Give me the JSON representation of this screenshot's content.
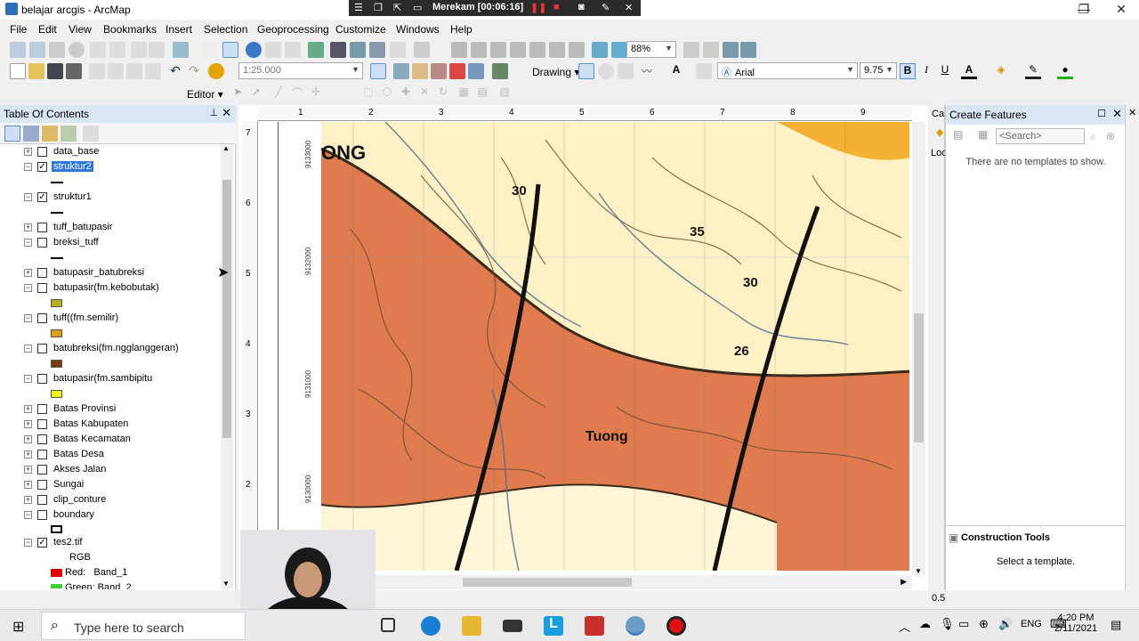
{
  "window": {
    "title": "belajar arcgis - ArcMap",
    "controls": [
      "—",
      "❐",
      "✕"
    ]
  },
  "recording": {
    "label": "Merekam [00:06:16]"
  },
  "menu": [
    "File",
    "Edit",
    "View",
    "Bookmarks",
    "Insert",
    "Selection",
    "Geoprocessing",
    "Customize",
    "Windows",
    "Help"
  ],
  "toolbar": {
    "zoom_value": "88%",
    "scale_value": "1:25.000",
    "drawing_label": "Drawing",
    "font_name": "Arial",
    "font_size": "9.75",
    "bold": "B",
    "italic": "I",
    "underline": "U",
    "editor_label": "Editor"
  },
  "toc": {
    "title": "Table Of Contents",
    "layers": [
      {
        "name": "data_base",
        "checked": false,
        "expanded": false
      },
      {
        "name": "struktur2",
        "checked": true,
        "expanded": true,
        "selected": true
      },
      {
        "name": "struktur1",
        "checked": true,
        "expanded": true
      },
      {
        "name": "tuff_batupasir",
        "checked": false,
        "expanded": false
      },
      {
        "name": "breksi_tuff",
        "checked": false,
        "expanded": true
      },
      {
        "name": "batupasir_batubreksi",
        "checked": false,
        "expanded": false
      },
      {
        "name": "batupasir(fm.kebobutak)",
        "checked": false,
        "expanded": true
      },
      {
        "name": "tuff((fm.semilir)",
        "checked": false,
        "expanded": true
      },
      {
        "name": "batubreksi(fm.ngglanggeran)",
        "checked": false,
        "expanded": true
      },
      {
        "name": "batupasir(fm.sambipitu",
        "checked": false,
        "expanded": true
      },
      {
        "name": "Batas Provinsi",
        "checked": false,
        "expanded": false
      },
      {
        "name": "Batas Kabupaten",
        "checked": false,
        "expanded": false
      },
      {
        "name": "Batas Kecamatan",
        "checked": false,
        "expanded": false
      },
      {
        "name": "Batas Desa",
        "checked": false,
        "expanded": false
      },
      {
        "name": "Akses Jalan",
        "checked": false,
        "expanded": false
      },
      {
        "name": "Sungai",
        "checked": false,
        "expanded": false
      },
      {
        "name": "clip_conture",
        "checked": false,
        "expanded": false
      },
      {
        "name": "boundary",
        "checked": false,
        "expanded": true
      },
      {
        "name": "tes2.tif",
        "checked": true,
        "expanded": true
      }
    ],
    "raster_rgb": "RGB",
    "raster_red": "Red:   Band_1",
    "raster_green": "Green: Band_2",
    "colors": {
      "kebobutak": "#b7ad1e",
      "semilir": "#d9a012",
      "ngglanggeran": "#7a3a12",
      "sambipitu": "#f5f21a",
      "red": "#e00000",
      "green": "#3bd13b"
    }
  },
  "map": {
    "ruler_h": [
      "1",
      "2",
      "3",
      "4",
      "5",
      "6",
      "7",
      "8",
      "9"
    ],
    "ruler_v": [
      "7",
      "6",
      "5",
      "4",
      "3",
      "2"
    ],
    "coord_labels": [
      "9133000",
      "9132000",
      "9131000",
      "9130000"
    ],
    "labels": [
      "ONG",
      "30",
      "35",
      "30",
      "26",
      "Tuong"
    ],
    "colors": {
      "cream": "#fef1c6",
      "orange": "#e07a4f",
      "yellow": "#f3b233"
    }
  },
  "create_features": {
    "title": "Create Features",
    "search_placeholder": "<Search>",
    "empty_text": "There are no templates to show.",
    "construction_title": "Construction Tools",
    "construction_text": "Select a template."
  },
  "side_tabs": {
    "left": [
      "Ca",
      "Loc"
    ],
    "bottom": "0.5"
  },
  "taskbar": {
    "search_placeholder": "Type here to search",
    "time": "4:20 PM",
    "date": "2/11/2021",
    "lang": "ENG"
  }
}
